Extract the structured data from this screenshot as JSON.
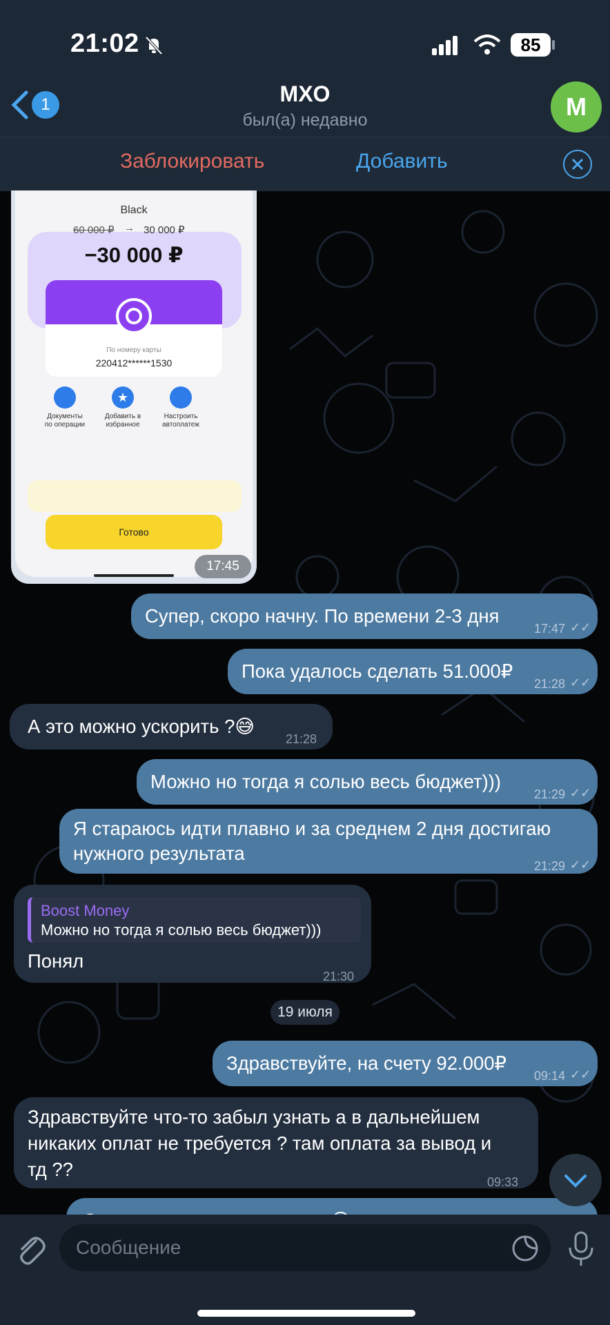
{
  "status": {
    "time": "21:02",
    "battery": "85"
  },
  "header": {
    "back_count": "1",
    "title": "MXO",
    "subtitle": "был(а) недавно",
    "avatar_letter": "M"
  },
  "actions": {
    "block": "Заблокировать",
    "add": "Добавить"
  },
  "photo": {
    "card_name": "Black",
    "old_amount": "60 000 ₽",
    "new_amount": "30 000 ₽",
    "amount": "−30 000 ₽",
    "card_caption": "По номеру карты",
    "card_number": "220412******1530",
    "actions": [
      {
        "label1": "Документы",
        "label2": "по операции"
      },
      {
        "label1": "Добавить в",
        "label2": "избранное"
      },
      {
        "label1": "Настроить",
        "label2": "автоплатеж"
      }
    ],
    "done_button": "Готово",
    "time": "17:45"
  },
  "messages": [
    {
      "dir": "out",
      "text": "Супер, скоро начну. По времени 2-3 дня",
      "time": "17:47"
    },
    {
      "dir": "out",
      "text": "Пока удалось сделать 51.000₽",
      "time": "21:28"
    },
    {
      "dir": "in",
      "text": "А это можно ускорить ?😅",
      "time": "21:28"
    },
    {
      "dir": "out",
      "text": "Можно но тогда я солью весь бюджет)))",
      "time": "21:29"
    },
    {
      "dir": "out",
      "text1": "Я стараюсь идти плавно и за среднем 2 дня достигаю",
      "text2": "нужного результата",
      "time": "21:29"
    },
    {
      "dir": "in",
      "reply_name": "Boost Money",
      "reply_text": "Можно но тогда я солью весь бюджет)))",
      "text": "Понял",
      "time": "21:30"
    },
    {
      "dir": "date",
      "text": "19 июля"
    },
    {
      "dir": "out",
      "text": "Здравствуйте, на счету 92.000₽",
      "time": "09:14"
    },
    {
      "dir": "in",
      "text1": "Здравствуйте что-то забыл узнать а в дальнейшем",
      "text2": "никаких оплат не требуется ? там оплата за вывод и",
      "text3": "тд ??",
      "time": "09:33"
    },
    {
      "dir": "out",
      "text": "Оплаты за вывод такого нет😅"
    }
  ],
  "input": {
    "placeholder": "Сообщение"
  },
  "colors": {
    "header_bg": "#1d2836",
    "out_bubble": "#4d7aa1",
    "in_bubble": "#232f3f",
    "accent": "#4aa6ee",
    "danger": "#e26b60",
    "reply_accent": "#9b6cf2"
  }
}
